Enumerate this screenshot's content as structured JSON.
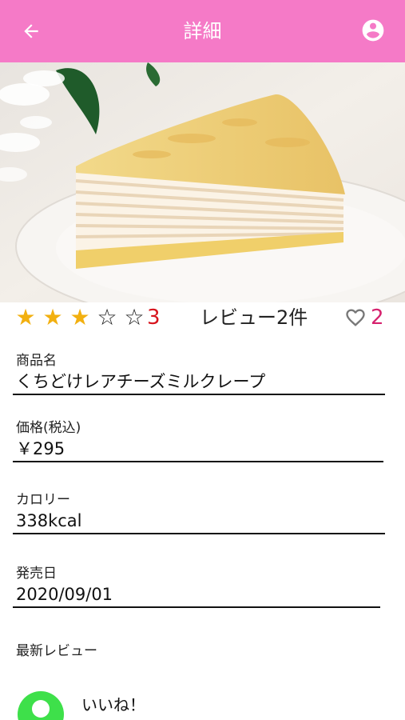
{
  "header": {
    "title": "詳細",
    "color": "#f57ac7"
  },
  "rating": {
    "score": "3",
    "stars_filled": 3,
    "stars_total": 5,
    "review_count_label": "レビュー2件",
    "like_count": "2"
  },
  "fields": {
    "product_name": {
      "label": "商品名",
      "value": "くちどけレアチーズミルクレープ"
    },
    "price": {
      "label": "価格(税込)",
      "value": "￥295"
    },
    "calorie": {
      "label": "カロリー",
      "value": "338kcal"
    },
    "release_date": {
      "label": "発売日",
      "value": "2020/09/01"
    }
  },
  "latest_review": {
    "label": "最新レビュー",
    "comment": "いいね！",
    "avatar_color": "#3ee04a"
  },
  "icons": {
    "back": "arrow-left-icon",
    "account": "account-circle-icon",
    "like": "heart-outline-icon"
  }
}
